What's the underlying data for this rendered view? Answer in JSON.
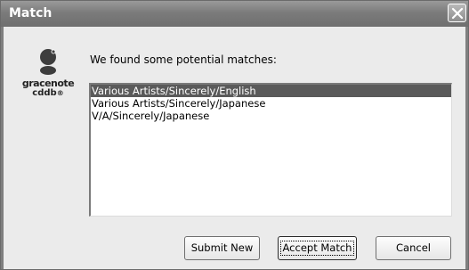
{
  "dialog": {
    "title": "Match",
    "message": "We found some potential matches:"
  },
  "logo": {
    "icon": "gracenote-logo-icon",
    "word": "gracenote",
    "sub": "cddb"
  },
  "matches": {
    "items": [
      "Various Artists/Sincerely/English",
      "Various Artists/Sincerely/Japanese",
      "V/A/Sincerely/Japanese"
    ],
    "selected_index": 0
  },
  "buttons": {
    "submit_new": "Submit New",
    "accept_match": "Accept Match",
    "cancel": "Cancel"
  }
}
